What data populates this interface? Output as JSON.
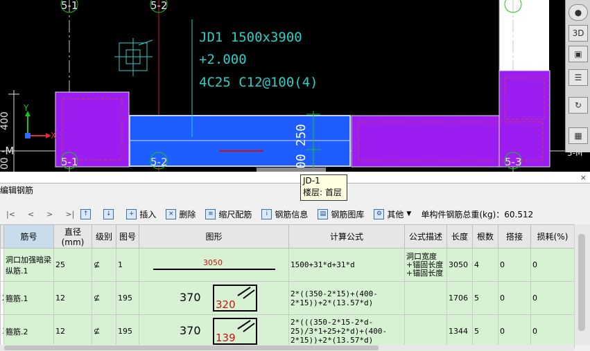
{
  "cad": {
    "annotation": [
      "JD1 1500x3900",
      "+2.000",
      "4C25 C12@100(4)"
    ],
    "axis_top": [
      "5-1",
      "5-2"
    ],
    "axis_bottom": [
      "5-1",
      "5-2",
      "5-3"
    ],
    "left_dims": [
      "400",
      "-M",
      "00"
    ],
    "right_edge_label": "5-M",
    "dim_vertical": "00 250",
    "y_axis_label": "Y",
    "x_axis_label": "X",
    "colors": {
      "purple": "#9b1df0",
      "blue": "#1e5dff",
      "cyan": "#2bd0c8",
      "red": "#d01010",
      "green": "#18c418"
    }
  },
  "side_tools": [
    "sphere-icon",
    "3d-box-icon",
    "cube-icon",
    "rotate-icon",
    "layers-icon"
  ],
  "tooltip": {
    "line1": "JD-1",
    "line2": "楼层: 首层"
  },
  "panel": {
    "title": "编辑钢筋",
    "close": "×"
  },
  "toolbar": {
    "nav": [
      "|<",
      "<",
      ">",
      ">|"
    ],
    "insert": "插入",
    "delete": "删除",
    "scale_rebar": "缩尺配筋",
    "rebar_info": "钢筋信息",
    "rebar_library": "钢筋图库",
    "other": "其他",
    "total_weight": "单构件钢筋总重(kg)：60.512"
  },
  "table": {
    "headers": [
      "筋号",
      "直径(mm)",
      "级别",
      "图号",
      "图形",
      "计算公式",
      "公式描述",
      "长度",
      "根数",
      "搭接",
      "损耗(%)"
    ],
    "rows": [
      {
        "idx": "",
        "name": "洞口加强暗梁纵筋.1",
        "diameter": "25",
        "grade": "⊈",
        "figure": "1",
        "shape_len": "3050",
        "formula": "1500+31*d+31*d",
        "desc": "洞口宽度+锚固长度+锚固长度",
        "length": "3050",
        "count": "4",
        "lap": "0",
        "loss": "0"
      },
      {
        "idx": "2",
        "name": "箍筋.1",
        "diameter": "12",
        "grade": "⊈",
        "figure": "195",
        "shape_a": "370",
        "shape_b": "320",
        "formula": "2*((350-2*15)+(400-2*15))+2*(13.57*d)",
        "desc": "",
        "length": "1706",
        "count": "5",
        "lap": "0",
        "loss": "0"
      },
      {
        "idx": "3",
        "name": "箍筋.2",
        "diameter": "12",
        "grade": "⊈",
        "figure": "195",
        "shape_a": "370",
        "shape_b": "139",
        "formula": "2*(((350-2*15-2*d-25)/3*1+25+2*d)+(400-2*15))+2*(13.57*d)",
        "desc": "",
        "length": "1344",
        "count": "5",
        "lap": "0",
        "loss": "0"
      }
    ]
  }
}
